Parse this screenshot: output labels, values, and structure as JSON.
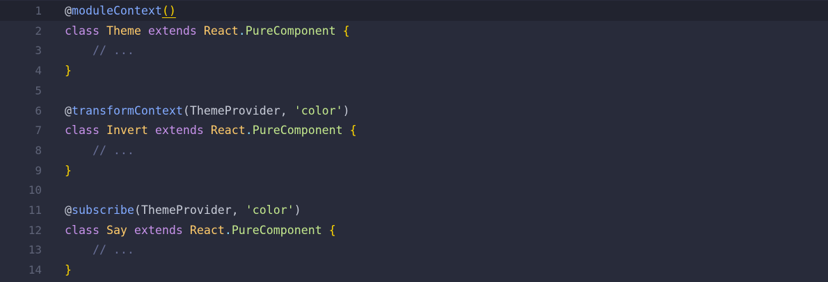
{
  "colors": {
    "background": "#282b3a",
    "active_line": "#21232f",
    "line_number": "#5f6478",
    "keyword": "#c792ea",
    "function": "#82aaff",
    "class_name": "#ffcb6b",
    "member": "#c3e88d",
    "string": "#c3e88d",
    "brace": "#ffd700",
    "comment": "#697098"
  },
  "lines": [
    {
      "n": "1",
      "active": true,
      "tokens": [
        [
          "tok-at",
          "@"
        ],
        [
          "tok-fn",
          "moduleContext"
        ],
        [
          "tok-paren cursor-underline",
          "()"
        ]
      ]
    },
    {
      "n": "2",
      "tokens": [
        [
          "tok-kw",
          "class "
        ],
        [
          "tok-cls",
          "Theme "
        ],
        [
          "tok-kw",
          "extends "
        ],
        [
          "tok-cls",
          "React"
        ],
        [
          "tok-punc",
          "."
        ],
        [
          "tok-member",
          "PureComponent "
        ],
        [
          "tok-brace",
          "{"
        ]
      ]
    },
    {
      "n": "3",
      "tokens": [
        [
          "tok-comment",
          "    // ..."
        ]
      ]
    },
    {
      "n": "4",
      "tokens": [
        [
          "tok-brace",
          "}"
        ]
      ]
    },
    {
      "n": "5",
      "tokens": []
    },
    {
      "n": "6",
      "tokens": [
        [
          "tok-at",
          "@"
        ],
        [
          "tok-fn",
          "transformContext"
        ],
        [
          "tok-plain",
          "(ThemeProvider, "
        ],
        [
          "tok-str",
          "'color'"
        ],
        [
          "tok-plain",
          ")"
        ]
      ]
    },
    {
      "n": "7",
      "tokens": [
        [
          "tok-kw",
          "class "
        ],
        [
          "tok-cls",
          "Invert "
        ],
        [
          "tok-kw",
          "extends "
        ],
        [
          "tok-cls",
          "React"
        ],
        [
          "tok-punc",
          "."
        ],
        [
          "tok-member",
          "PureComponent "
        ],
        [
          "tok-brace",
          "{"
        ]
      ]
    },
    {
      "n": "8",
      "tokens": [
        [
          "tok-comment",
          "    // ..."
        ]
      ]
    },
    {
      "n": "9",
      "tokens": [
        [
          "tok-brace",
          "}"
        ]
      ]
    },
    {
      "n": "10",
      "tokens": []
    },
    {
      "n": "11",
      "tokens": [
        [
          "tok-at",
          "@"
        ],
        [
          "tok-fn",
          "subscribe"
        ],
        [
          "tok-plain",
          "(ThemeProvider, "
        ],
        [
          "tok-str",
          "'color'"
        ],
        [
          "tok-plain",
          ")"
        ]
      ]
    },
    {
      "n": "12",
      "tokens": [
        [
          "tok-kw",
          "class "
        ],
        [
          "tok-cls",
          "Say "
        ],
        [
          "tok-kw",
          "extends "
        ],
        [
          "tok-cls",
          "React"
        ],
        [
          "tok-punc",
          "."
        ],
        [
          "tok-member",
          "PureComponent "
        ],
        [
          "tok-brace",
          "{"
        ]
      ]
    },
    {
      "n": "13",
      "tokens": [
        [
          "tok-comment",
          "    // ..."
        ]
      ]
    },
    {
      "n": "14",
      "tokens": [
        [
          "tok-brace",
          "}"
        ]
      ]
    }
  ]
}
